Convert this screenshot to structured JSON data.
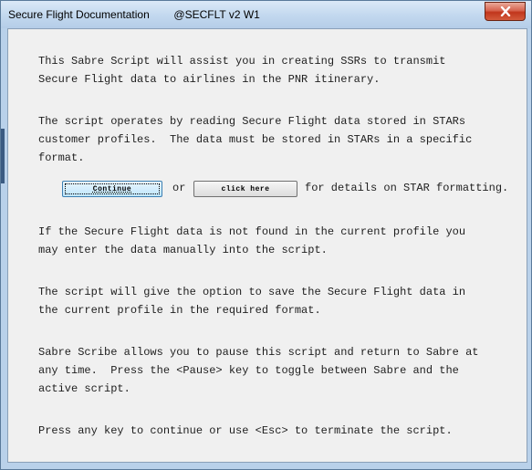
{
  "window": {
    "title": "Secure Flight Documentation",
    "subtitle": "@SECFLT v2 W1"
  },
  "icons": {
    "close": "close-icon"
  },
  "body": {
    "line1": "This Sabre Script will assist you in creating SSRs to transmit",
    "line2": "Secure Flight data to airlines in the PNR itinerary.",
    "line3": "The script operates by reading Secure Flight data stored in STARs",
    "line4": "customer profiles.  The data must be stored in STARs in a specific",
    "line5": "format.",
    "or_text": "or",
    "details_text": "for details on STAR formatting.",
    "line6": "If the Secure Flight data is not found in the current profile you",
    "line7": "may enter the data manually into the script.",
    "line8": "The script will give the option to save the Secure Flight data in",
    "line9": "the current profile in the required format.",
    "line10": "Sabre Scribe allows you to pause this script and return to Sabre at",
    "line11": "any time.  Press the <Pause> key to toggle between Sabre and the",
    "line12": "active script.",
    "line13": "Press any key to continue or use <Esc> to terminate the script."
  },
  "buttons": {
    "continue_label": "Continue",
    "click_here_label": "click here"
  },
  "colors": {
    "title_gradient_top": "#dbe9f7",
    "close_button_red": "#c1361c",
    "content_bg": "#f0f0f0",
    "focused_button": "#bee6fd"
  }
}
